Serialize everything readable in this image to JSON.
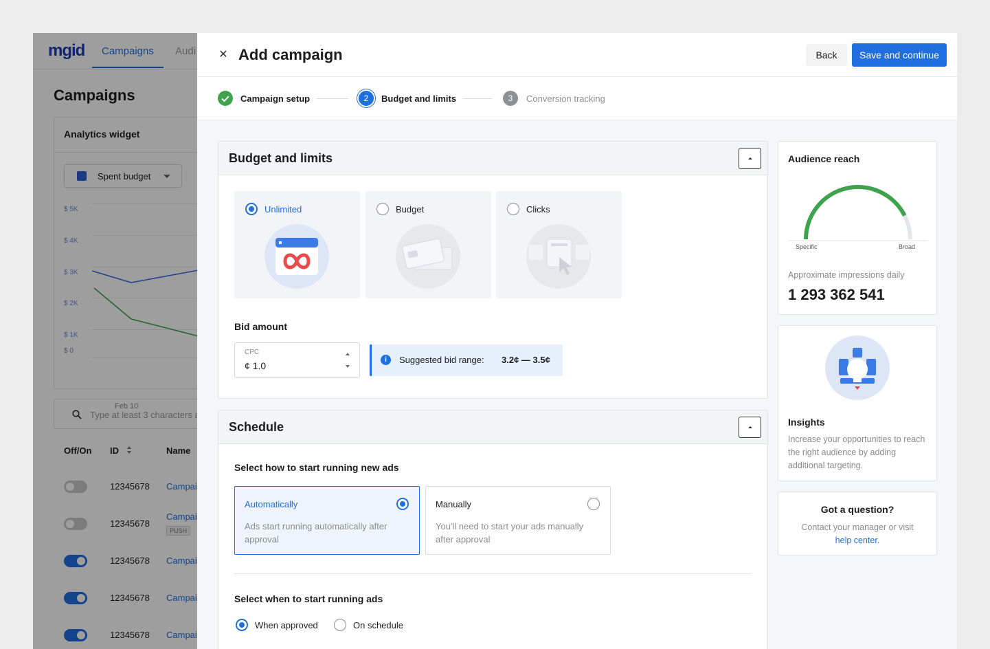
{
  "background_app": {
    "logo": "mgid",
    "tabs": [
      "Campaigns",
      "Audi"
    ],
    "page_title": "Campaigns",
    "widget_title": "Analytics widget",
    "metric_select": "Spent budget",
    "y_ticks": [
      "$ 5K",
      "$ 4K",
      "$ 3K",
      "$ 2K",
      "$ 1K",
      "$ 0"
    ],
    "x_tick": "Feb 10",
    "search_placeholder": "Type at least 3 characters a",
    "table_headers": [
      "Off/On",
      "ID",
      "Name"
    ],
    "rows": [
      {
        "on": false,
        "id": "12345678",
        "name": "Campai",
        "badge": ""
      },
      {
        "on": false,
        "id": "12345678",
        "name": "Campai",
        "badge": "PUSH"
      },
      {
        "on": true,
        "id": "12345678",
        "name": "Campai",
        "badge": ""
      },
      {
        "on": true,
        "id": "12345678",
        "name": "Campai",
        "badge": ""
      },
      {
        "on": true,
        "id": "12345678",
        "name": "Campai",
        "badge": ""
      }
    ]
  },
  "drawer": {
    "title": "Add campaign",
    "back_label": "Back",
    "save_label": "Save and continue",
    "steps": [
      {
        "number": "",
        "label": "Campaign setup",
        "state": "done"
      },
      {
        "number": "2",
        "label": "Budget and limits",
        "state": "active"
      },
      {
        "number": "3",
        "label": "Conversion tracking",
        "state": "pending"
      }
    ]
  },
  "budget": {
    "title": "Budget and limits",
    "options": [
      {
        "label": "Unlimited",
        "selected": true
      },
      {
        "label": "Budget",
        "selected": false
      },
      {
        "label": "Clicks",
        "selected": false
      }
    ],
    "bid_label": "Bid amount",
    "cpc_caption": "CPC",
    "cpc_value": "¢ 1.0",
    "suggested_label": "Suggested bid range:",
    "suggested_range": "3.2¢ — 3.5¢"
  },
  "schedule": {
    "title": "Schedule",
    "start_question": "Select how to start running new ads",
    "modes": [
      {
        "title": "Automatically",
        "desc": "Ads start running automatically after approval",
        "selected": true
      },
      {
        "title": "Manually",
        "desc": "You'll need to start your ads manually after approval",
        "selected": false
      }
    ],
    "when_question": "Select when to start running ads",
    "when_options": [
      {
        "label": "When approved",
        "selected": true
      },
      {
        "label": "On schedule",
        "selected": false
      }
    ]
  },
  "audience": {
    "title": "Audience reach",
    "gauge_left": "Specific",
    "gauge_right": "Broad",
    "gauge_level": 0.85,
    "impressions_label": "Approximate impressions daily",
    "impressions_value": "1 293 362 541"
  },
  "insights": {
    "title": "Insights",
    "text": "Increase your opportunities to reach the right audience by adding additional targeting."
  },
  "question": {
    "title": "Got a question?",
    "text_before": "Contact your manager or visit",
    "link": "help center."
  },
  "colors": {
    "accent": "#1f6fe0",
    "success": "#3fa34d",
    "gauge": "#3fa34d"
  }
}
